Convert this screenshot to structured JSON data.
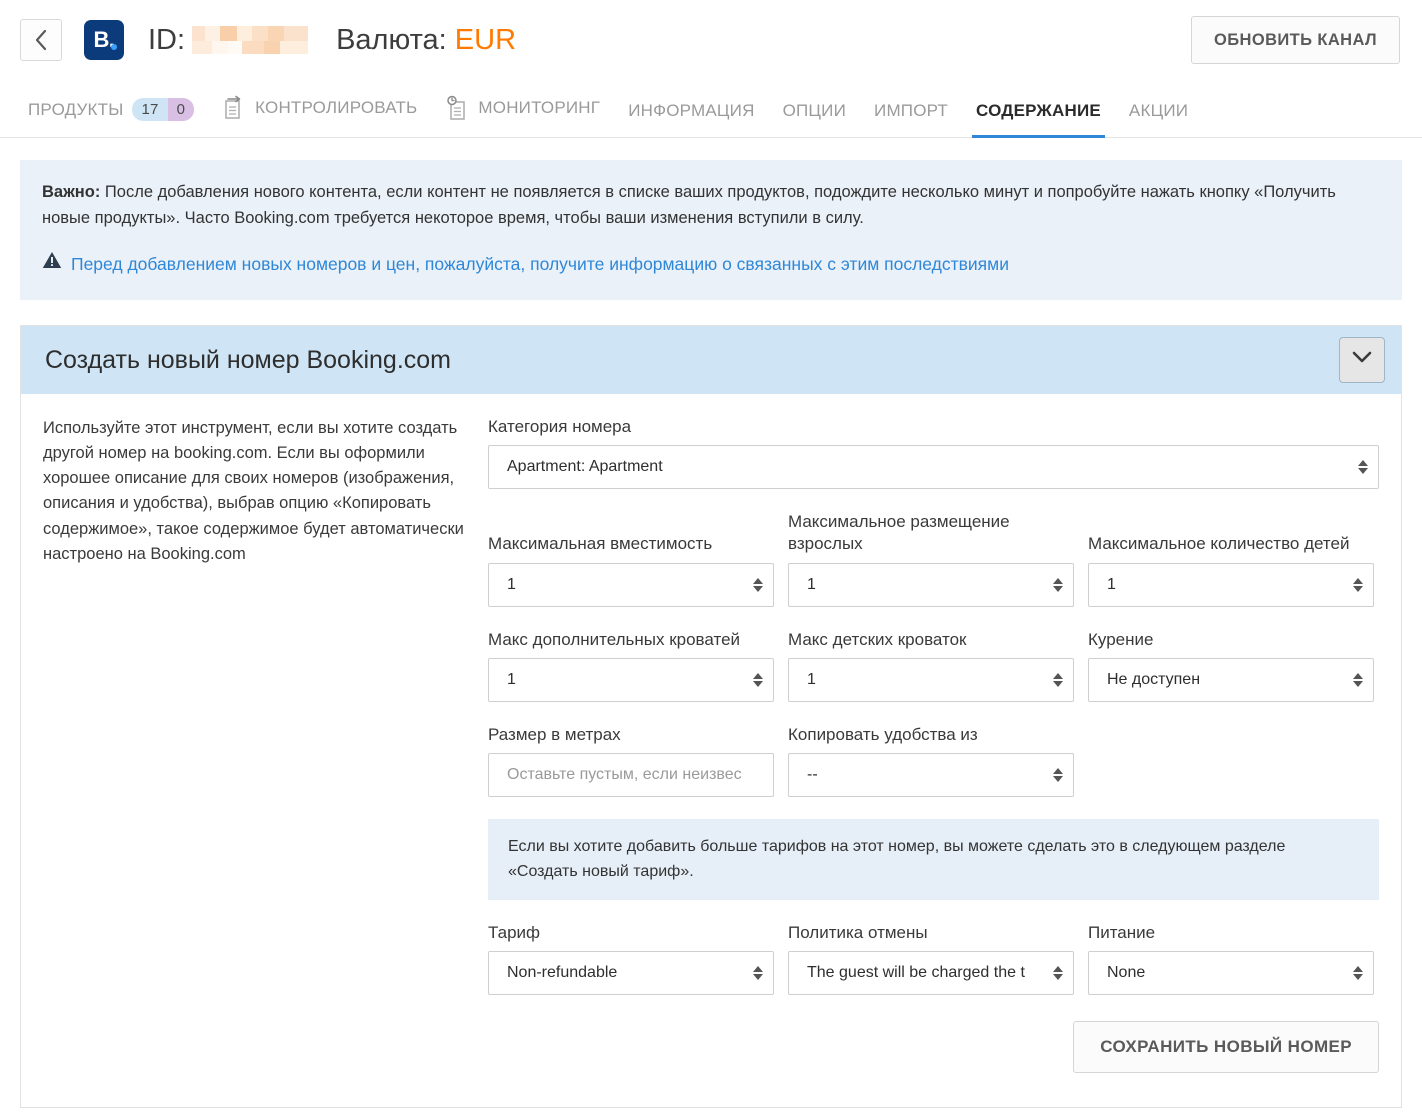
{
  "header": {
    "back_icon": "chevron-left-icon",
    "logo_text": "B.",
    "id_label": "ID:",
    "id_value_redacted": "",
    "currency_label": "Валюта:",
    "currency_value": "EUR",
    "update_channel_label": "ОБНОВИТЬ КАНАЛ"
  },
  "tabs": [
    {
      "label": "ПРОДУКТЫ",
      "active": false,
      "badge": {
        "count_left": "17",
        "count_right": "0"
      }
    },
    {
      "label": "КОНТРОЛИРОВАТЬ",
      "active": false,
      "icon": "document-arrow-icon"
    },
    {
      "label": "МОНИТОРИНГ",
      "active": false,
      "icon": "document-clock-icon"
    },
    {
      "label": "ИНФОРМАЦИЯ",
      "active": false
    },
    {
      "label": "ОПЦИИ",
      "active": false
    },
    {
      "label": "ИМПОРТ",
      "active": false
    },
    {
      "label": "СОДЕРЖАНИЕ",
      "active": true
    },
    {
      "label": "АКЦИИ",
      "active": false
    }
  ],
  "notice": {
    "strong": "Важно:",
    "body": " После добавления нового контента, если контент не появляется в списке ваших продуктов, подождите несколько минут и попробуйте нажать кнопку «Получить новые продукты». Часто Booking.com требуется некоторое время, чтобы ваши изменения вступили в силу.",
    "warning_icon": "warning-triangle-icon",
    "link_text": "Перед добавлением новых номеров и цен, пожалуйста, получите информацию о связанных с этим последствиями",
    "link_color": "#2f87d8",
    "background": "#eaf1f8"
  },
  "panel": {
    "title": "Создать новый номер Booking.com",
    "header_background": "#cfe5f5",
    "collapse_icon": "chevron-down-icon",
    "description": "Используйте этот инструмент, если вы хотите создать другой номер на booking.com. Если вы оформили хорошее описание для своих номеров (изображения, описания и удобства), выбрав опцию «Копировать содержимое», такое содержимое будет автоматически настроено на Booking.com",
    "fields": {
      "room_category": {
        "label": "Категория номера",
        "value": "Apartment: Apartment"
      },
      "max_capacity": {
        "label": "Максимальная вместимость",
        "value": "1"
      },
      "max_adults": {
        "label": "Максимальное размещение взрослых",
        "value": "1"
      },
      "max_children": {
        "label": "Максимальное количество детей",
        "value": "1"
      },
      "max_extra_beds": {
        "label": "Макс дополнительных кроватей",
        "value": "1"
      },
      "max_cribs": {
        "label": "Макс детских кроваток",
        "value": "1"
      },
      "smoking": {
        "label": "Курение",
        "value": "Не доступен"
      },
      "size_meters": {
        "label": "Размер в метрах",
        "value": "",
        "placeholder": "Оставьте пустым, если неизвес"
      },
      "copy_amenities": {
        "label": "Копировать удобства из",
        "value": "--"
      },
      "rate": {
        "label": "Тариф",
        "value": "Non-refundable"
      },
      "cancellation_policy": {
        "label": "Политика отмены",
        "value": "The guest will be charged the t"
      },
      "meal_plan": {
        "label": "Питание",
        "value": "None"
      }
    },
    "inline_note": "Если вы хотите добавить больше тарифов на этот номер, вы можете сделать это в следующем разделе «Создать новый тариф».",
    "save_label": "СОХРАНИТЬ НОВЫЙ НОМЕР"
  }
}
